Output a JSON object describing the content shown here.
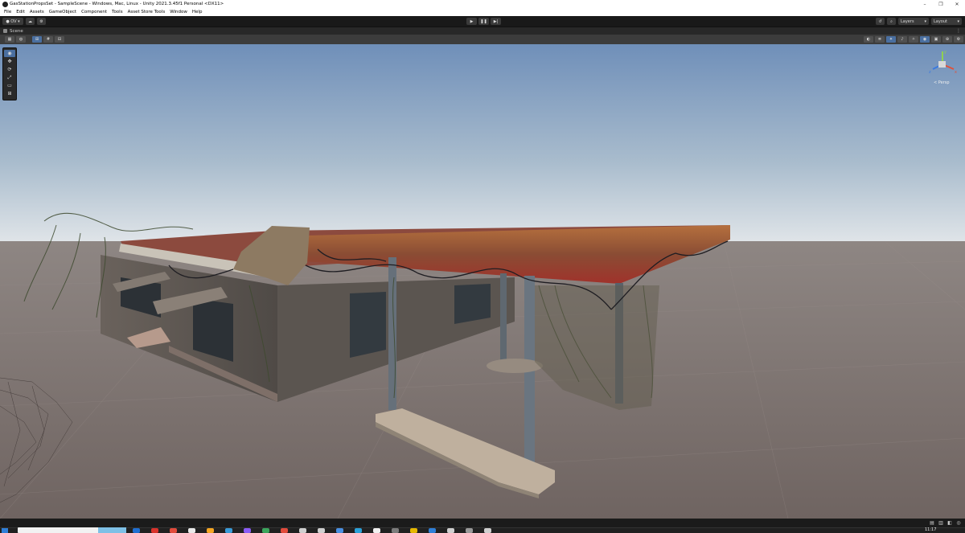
{
  "window": {
    "title": "GasStationPropsSet - SampleScene - Windows, Mac, Linux - Unity 2021.3.45f1 Personal <DX11>",
    "minimize_glyph": "–",
    "maximize_glyph": "❐",
    "close_glyph": "✕"
  },
  "menu": [
    "File",
    "Edit",
    "Assets",
    "GameObject",
    "Component",
    "Tools",
    "Asset Store Tools",
    "Window",
    "Help"
  ],
  "toolbar": {
    "account_label": "OV",
    "account_icon": "user-icon",
    "cloud_icon": "cloud-icon",
    "collab_icon": "gear-icon",
    "play_glyph": "▶",
    "pause_glyph": "❚❚",
    "step_glyph": "▶|",
    "history_icon": "history-icon",
    "search_icon": "search-icon",
    "layers_label": "Layers",
    "layout_label": "Layout"
  },
  "scene_tab": {
    "label": "Scene",
    "menu_glyph": "⋮"
  },
  "scene_tools": [
    "view-tool",
    "move-tool",
    "rotate-tool",
    "scale-tool",
    "rect-tool",
    "transform-tool"
  ],
  "gizmo": {
    "label": "< Persp",
    "axis_y": "y",
    "axis_x": "x",
    "axis_z": "z"
  },
  "taskbar": {
    "clock": "11:17"
  },
  "colors": {
    "sky_top": "#6f8fb9",
    "sky_horizon": "#dfe4e8",
    "ground": "#7d716d",
    "roof": "#8c4a3e",
    "accent": "#4a6fa0"
  }
}
